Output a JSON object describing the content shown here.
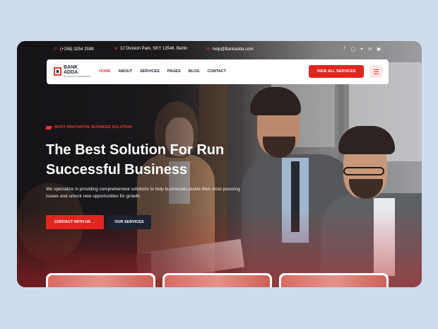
{
  "topbar": {
    "phone": "(+258) 3254 2598",
    "address": "12 Division Park, SKY 12546. Berlin",
    "email": "help@Bankadda.com",
    "social_icons": [
      "facebook-icon",
      "instagram-icon",
      "twitter-icon",
      "whatsapp-icon",
      "linkedin-icon"
    ]
  },
  "nav": {
    "logo_name_line1": "BANK",
    "logo_name_line2": "ADDA",
    "logo_tag": "BY LOAN TO INVESTMENT",
    "items": [
      {
        "label": "HOME",
        "active": true
      },
      {
        "label": "ABOUT",
        "active": false
      },
      {
        "label": "SERVICES",
        "active": false
      },
      {
        "label": "PAGES",
        "active": false
      },
      {
        "label": "BLOG",
        "active": false
      },
      {
        "label": "CONTACT",
        "active": false
      }
    ],
    "cta_label": "VIEW ALL SERVICES"
  },
  "hero": {
    "eyebrow": "MOST INNOVATIVE BUSINESS SOLUTION",
    "headline": "The Best Solution For Run Successful Business",
    "description": "We specialize in providing comprehensive solutions to help businesses tackle their most pressing issues and unlock new opportunities for growth.",
    "primary_button": "CONTACT WITH US →",
    "secondary_button": "OUR SERVICES"
  },
  "colors": {
    "accent": "#e0261f",
    "dark": "#1b2232",
    "page_bg": "#cfdcee"
  }
}
